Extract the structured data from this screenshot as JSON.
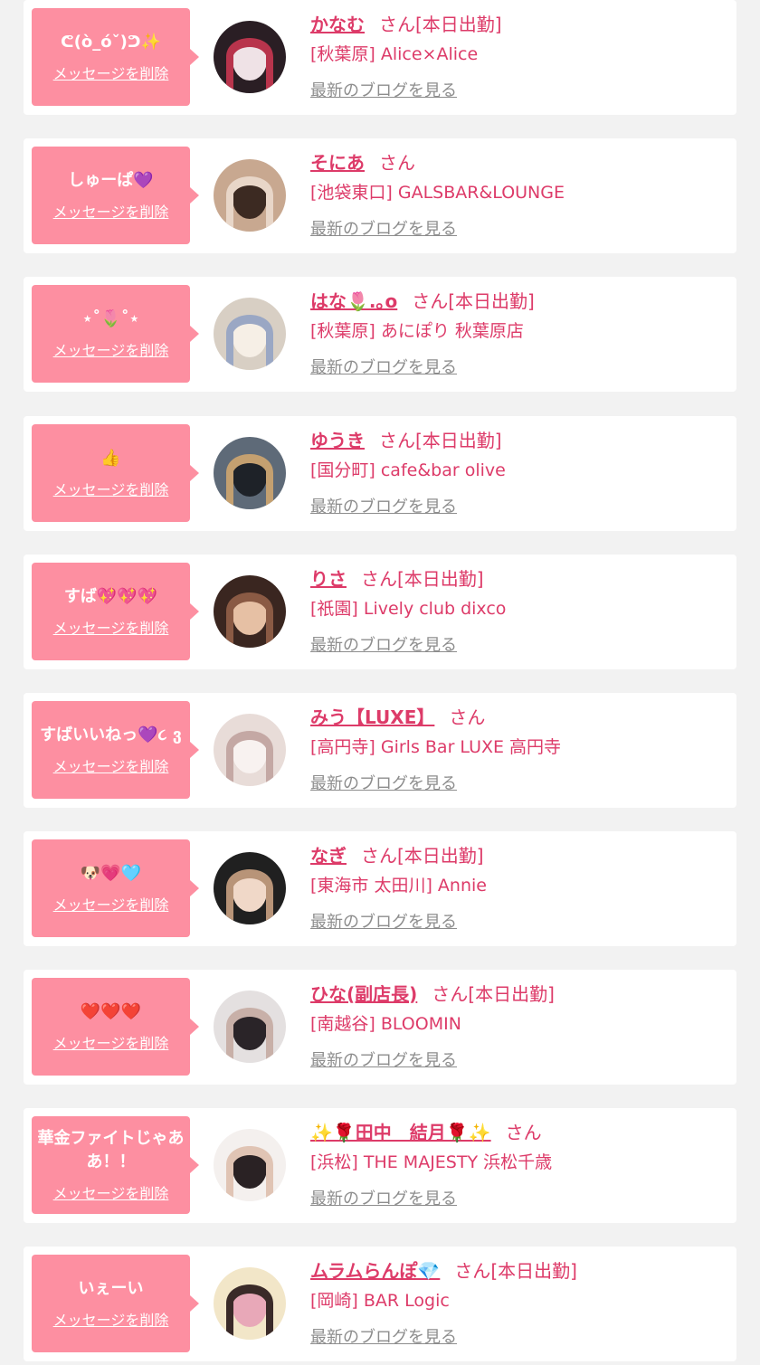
{
  "items": [
    {
      "message": "ᕦ(ò_óˇ)ᕤ✨",
      "delete_label": "メッセージを削除",
      "name": "かなむ",
      "suffix": "さん",
      "status": "[本日出勤]",
      "shop": "[秋葉原] Alice×Alice",
      "blog_label": "最新のブログを見る",
      "avatar_colors": [
        "#2a1e24",
        "#efe2e6",
        "#b8344c"
      ]
    },
    {
      "message": "しゅーぱ💜",
      "delete_label": "メッセージを削除",
      "name": "そにあ",
      "suffix": "さん",
      "status": "",
      "shop": "[池袋東口] GALSBAR&LOUNGE",
      "blog_label": "最新のブログを見る",
      "avatar_colors": [
        "#c8a890",
        "#3c2a22",
        "#e8d6c8"
      ]
    },
    {
      "message": "⋆˚🌷˚⋆",
      "delete_label": "メッセージを削除",
      "name": "はな🌷.｡o",
      "suffix": "さん",
      "status": "[本日出勤]",
      "shop": "[秋葉原] あにぽり 秋葉原店",
      "blog_label": "最新のブログを見る",
      "avatar_colors": [
        "#d8cfc4",
        "#f6efe6",
        "#9aa7c4"
      ]
    },
    {
      "message": "👍",
      "delete_label": "メッセージを削除",
      "name": "ゆうき",
      "suffix": "さん",
      "status": "[本日出勤]",
      "shop": "[国分町] cafe&bar olive",
      "blog_label": "最新のブログを見る",
      "avatar_colors": [
        "#5e6a78",
        "#1e2228",
        "#c4a070"
      ]
    },
    {
      "message": "すば💖💖💖",
      "delete_label": "メッセージを削除",
      "name": "りさ",
      "suffix": "さん",
      "status": "[本日出勤]",
      "shop": "[祇園] Lively club dixco",
      "blog_label": "最新のブログを見る",
      "avatar_colors": [
        "#3a2620",
        "#e6c0a4",
        "#8a5a44"
      ]
    },
    {
      "message": "すばいいねっ💜૮ ვ",
      "delete_label": "メッセージを削除",
      "name": "みう【LUXE】",
      "suffix": "さん",
      "status": "",
      "shop": "[高円寺] Girls Bar LUXE 高円寺",
      "blog_label": "最新のブログを見る",
      "avatar_colors": [
        "#e8dcd8",
        "#f8f2f0",
        "#c4a8a4"
      ]
    },
    {
      "message": "🐶💗🩵",
      "delete_label": "メッセージを削除",
      "name": "なぎ",
      "suffix": "さん",
      "status": "[本日出勤]",
      "shop": "[東海市 太田川] Annie",
      "blog_label": "最新のブログを見る",
      "avatar_colors": [
        "#202020",
        "#f0d8c8",
        "#b89478"
      ]
    },
    {
      "message": "❤️❤️❤️",
      "delete_label": "メッセージを削除",
      "name": "ひな(副店長)",
      "suffix": "さん",
      "status": "[本日出勤]",
      "shop": "[南越谷] BLOOMIN",
      "blog_label": "最新のブログを見る",
      "avatar_colors": [
        "#e4e0e0",
        "#2a2428",
        "#c8b0a8"
      ]
    },
    {
      "message": "華金ファイトじゃああ！！",
      "delete_label": "メッセージを削除",
      "name": "✨🌹田中　結月🌹✨",
      "suffix": "さん",
      "status": "",
      "shop": "[浜松] THE MAJESTY 浜松千歳",
      "blog_label": "最新のブログを見る",
      "avatar_colors": [
        "#f4f0ee",
        "#2a2224",
        "#e0c4b4"
      ]
    },
    {
      "message": "いぇーい",
      "delete_label": "メッセージを削除",
      "name": "ムラムらんぽ💎",
      "suffix": "さん",
      "status": "[本日出勤]",
      "shop": "[岡崎] BAR Logic",
      "blog_label": "最新のブログを見る",
      "avatar_colors": [
        "#f2e6c8",
        "#e8a8b8",
        "#3a2a28"
      ]
    }
  ]
}
